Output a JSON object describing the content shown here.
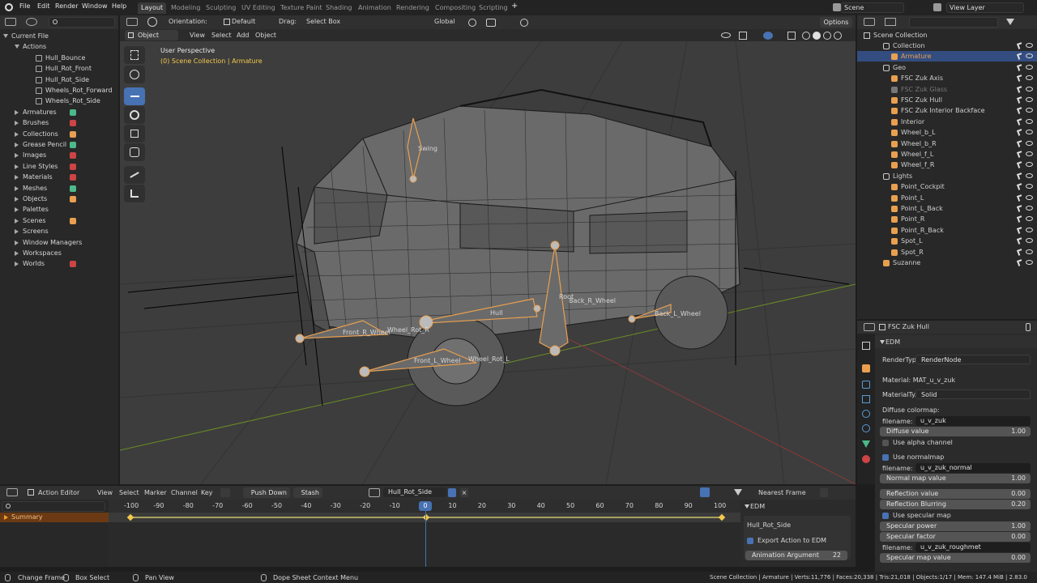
{
  "menu": {
    "items": [
      "File",
      "Edit",
      "Render",
      "Window",
      "Help"
    ]
  },
  "workspaces": [
    "Layout",
    "Modeling",
    "Sculpting",
    "UV Editing",
    "Texture Paint",
    "Shading",
    "Animation",
    "Rendering",
    "Compositing",
    "Scripting"
  ],
  "scene": {
    "scene_name": "Scene",
    "view_layer": "View Layer",
    "plus": "+"
  },
  "view3d_header": {
    "orientation_label": "Orientation:",
    "orientation_value": "Default",
    "drag_label": "Drag:",
    "drag_value": "Select Box",
    "transform_value": "Global",
    "options": "Options",
    "mode": "Object Mode",
    "menus": [
      "View",
      "Select",
      "Add",
      "Object"
    ]
  },
  "viewport": {
    "perspective": "User Perspective",
    "collection_info": "(0) Scene Collection | Armature",
    "bone_labels": [
      "Swing",
      "Hull",
      "Front_R_Wheel",
      "Wheel_Rot_R",
      "Front_L_Wheel",
      "Wheel_Rot_L",
      "Back_R_Wheel",
      "Back_L_Wheel",
      "Root"
    ]
  },
  "file_browser": {
    "root": "Current File",
    "actions_label": "Actions",
    "actions": [
      "Hull_Bounce",
      "Hull_Rot_Front",
      "Hull_Rot_Side",
      "Wheels_Rot_Forward",
      "Wheels_Rot_Side"
    ],
    "categories": [
      "Armatures",
      "Brushes",
      "Collections",
      "Grease Pencil",
      "Images",
      "Line Styles",
      "Materials",
      "Meshes",
      "Objects",
      "Palettes",
      "Scenes",
      "Screens",
      "Window Managers",
      "Workspaces",
      "Worlds"
    ],
    "badges": {
      "materials": "3",
      "meshes": "10",
      "objects": "3",
      "scenes": "4",
      "screens": "10",
      "workspaces": "10"
    }
  },
  "outliner": {
    "root": "Scene Collection",
    "items": [
      {
        "label": "Collection",
        "color": "#d0d0d0"
      },
      {
        "label": "Armature",
        "color": "#e8a050"
      },
      {
        "label": "Geo",
        "color": "#d0d0d0"
      },
      {
        "label": "FSC Zuk Axis",
        "color": "#d0d0d0"
      },
      {
        "label": "FSC Zuk Glass",
        "color": "#777777"
      },
      {
        "label": "FSC Zuk Hull",
        "color": "#d0d0d0"
      },
      {
        "label": "FSC Zuk Interior Backface",
        "color": "#d0d0d0"
      },
      {
        "label": "Interior",
        "color": "#d0d0d0"
      },
      {
        "label": "Wheel_b_L",
        "color": "#d0d0d0"
      },
      {
        "label": "Wheel_b_R",
        "color": "#d0d0d0"
      },
      {
        "label": "Wheel_f_L",
        "color": "#d0d0d0"
      },
      {
        "label": "Wheel_f_R",
        "color": "#d0d0d0"
      },
      {
        "label": "Lights",
        "color": "#d0d0d0"
      },
      {
        "label": "Point_Cockpit",
        "color": "#d0d0d0"
      },
      {
        "label": "Point_L",
        "color": "#d0d0d0"
      },
      {
        "label": "Point_L_Back",
        "color": "#d0d0d0"
      },
      {
        "label": "Point_R",
        "color": "#d0d0d0"
      },
      {
        "label": "Point_R_Back",
        "color": "#d0d0d0"
      },
      {
        "label": "Spot_L",
        "color": "#d0d0d0"
      },
      {
        "label": "Spot_R",
        "color": "#d0d0d0"
      },
      {
        "label": "Suzanne",
        "color": "#d0d0d0"
      }
    ]
  },
  "properties": {
    "object_name": "FSC Zuk Hull",
    "panel": "EDM",
    "render_type_label": "RenderType:",
    "render_type": "RenderNode",
    "material_label": "Material: MAT_u_v_zuk",
    "material_type_label": "MaterialTy...",
    "material_type": "Solid",
    "diffuse_colormap": "Diffuse colormap:",
    "filename_label": "filename:",
    "diffuse_file": "u_v_zuk",
    "diffuse_value_label": "Diffuse value",
    "diffuse_value": "1.00",
    "use_alpha": "Use alpha channel",
    "use_normalmap": "Use normalmap",
    "normal_file": "u_v_zuk_normal",
    "normal_value_label": "Normal map value",
    "normal_value": "1.00",
    "reflection_value_label": "Reflection value",
    "reflection_value": "0.00",
    "reflection_blur_label": "Reflection Blurring",
    "reflection_blur": "0.20",
    "use_specular": "Use specular map",
    "spec_power_label": "Specular power",
    "spec_power": "1.00",
    "spec_factor_label": "Specular factor",
    "spec_factor": "0.00",
    "spec_file": "u_v_zuk_roughmet",
    "spec_map_label": "Specular map value",
    "spec_map": "0.00"
  },
  "action_editor": {
    "mode": "Action Editor",
    "menus": [
      "View",
      "Select",
      "Marker",
      "Channel",
      "Key"
    ],
    "push_down": "Push Down",
    "stash": "Stash",
    "action": "Hull_Rot_Side",
    "snap": "Nearest Frame",
    "summary": "Summary",
    "ticks": [
      "-100",
      "-90",
      "-80",
      "-70",
      "-60",
      "-50",
      "-40",
      "-30",
      "-20",
      "-10",
      "0",
      "10",
      "20",
      "30",
      "40",
      "50",
      "60",
      "70",
      "80",
      "90",
      "100"
    ],
    "current_frame": "0",
    "side_panel": {
      "title": "EDM",
      "action_name": "Hull_Rot_Side",
      "export": "Export Action to EDM",
      "anim_arg_label": "Animation Argument",
      "anim_arg": "22"
    }
  },
  "statusbar": {
    "change_frame": "Change Frame",
    "box_select": "Box Select",
    "pan_view": "Pan View",
    "context": "Dope Sheet Context Menu",
    "info": "Scene Collection | Armature | Verts:11,776 | Faces:20,338 | Tris:21,018 | Objects:1/17 | Mem: 147.4 MiB | 2.83.0"
  }
}
